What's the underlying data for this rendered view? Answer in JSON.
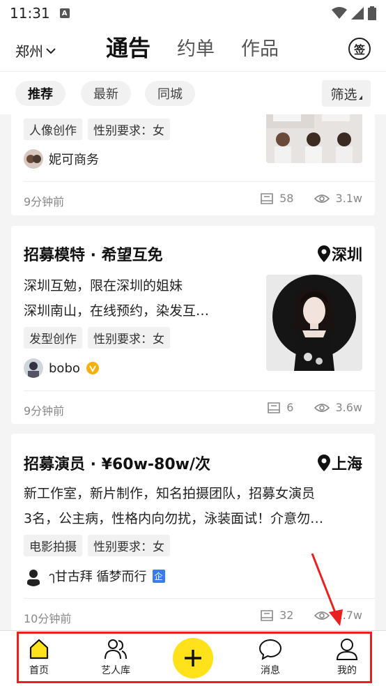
{
  "status": {
    "time": "11:31"
  },
  "nav": {
    "city": "郑州",
    "tabs": [
      "通告",
      "约单",
      "作品"
    ],
    "sign_label": "签"
  },
  "filters": {
    "chips": [
      "推荐",
      "最新",
      "同城"
    ],
    "filter_label": "筛选"
  },
  "cards": [
    {
      "tags": [
        "人像创作",
        "性别要求：女"
      ],
      "author": "妮可商务",
      "time": "9分钟前",
      "comments": "58",
      "views": "3.1w"
    },
    {
      "title": "招募模特 · 希望互免",
      "location": "深圳",
      "desc1": "深圳互勉，限在深圳的姐妹",
      "desc2": "深圳南山，在线预约，染发互…",
      "tags": [
        "发型创作",
        "性别要求：女"
      ],
      "author": "bobo",
      "time": "9分钟前",
      "comments": "6",
      "views": "3.6w"
    },
    {
      "title": "招募演员 · ¥60w-80w/次",
      "location": "上海",
      "desc1": "新工作室，新片制作，知名拍摄团队，招募女演员",
      "desc2": "3名，公主病，性格内向勿扰，泳装面试！介意勿…",
      "tags": [
        "电影拍摄",
        "性别要求：女"
      ],
      "author": "ๅ甘古拜 循梦而行",
      "enterprise_badge": "企",
      "time": "10分钟前",
      "comments": "32",
      "views": "1.7w"
    }
  ],
  "tabbar": {
    "items": [
      "首页",
      "艺人库",
      "消息",
      "我的"
    ]
  },
  "colors": {
    "accent": "#ffe21a",
    "highlight": "#e82020"
  }
}
